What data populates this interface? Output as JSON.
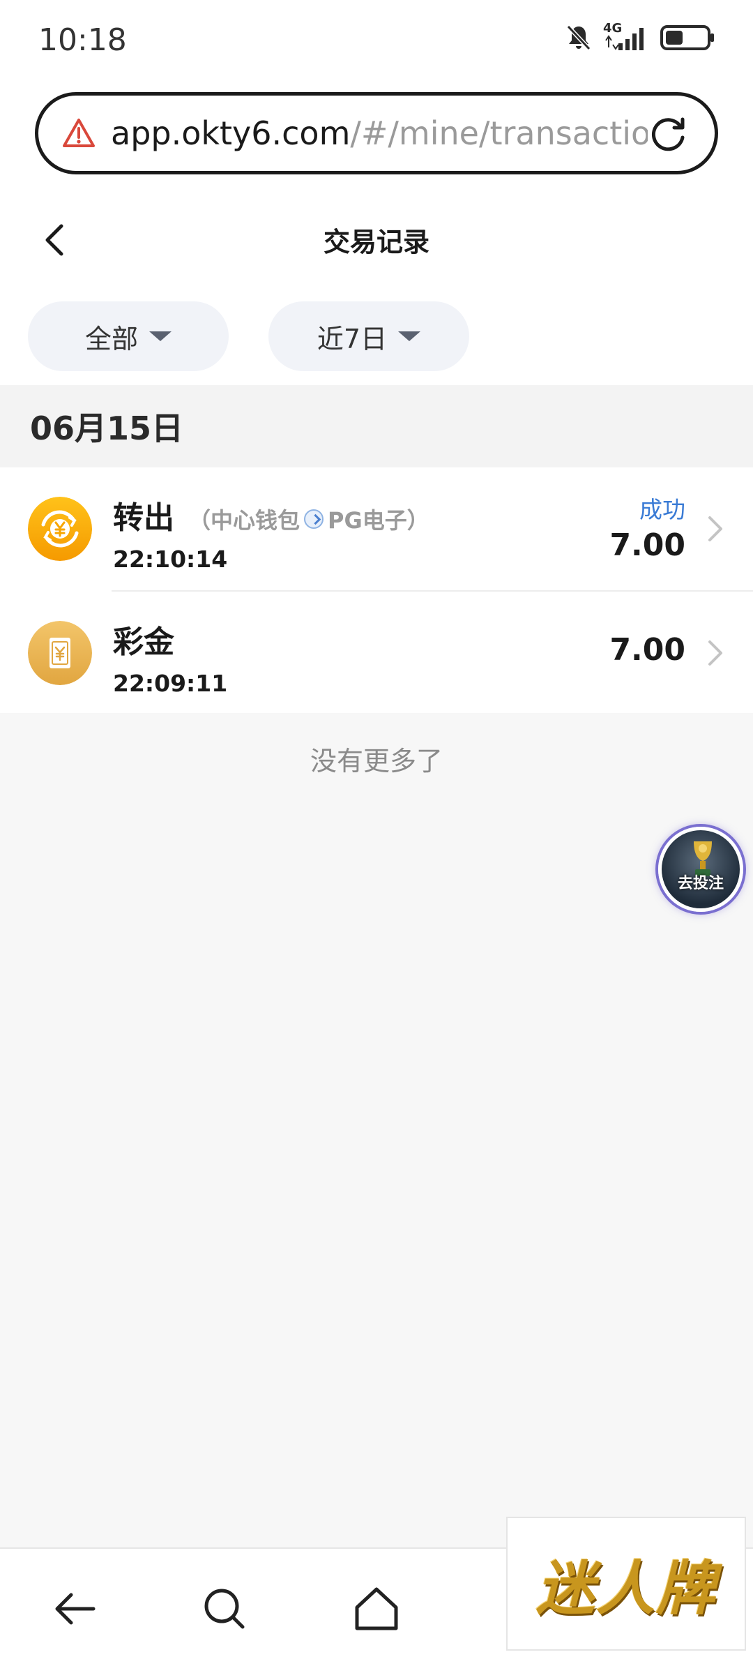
{
  "status_bar": {
    "time": "10:18",
    "network": "4G",
    "icons": [
      "bell-muted-icon",
      "signal-icon",
      "battery-icon"
    ]
  },
  "browser": {
    "url_host": "app.okty6.com",
    "url_path": "/#/mine/transactio",
    "icons": [
      "warning-icon",
      "reload-icon"
    ]
  },
  "header": {
    "title": "交易记录"
  },
  "filters": {
    "type_label": "全部",
    "range_label": "近7日"
  },
  "date_group": {
    "label": "06月15日"
  },
  "transactions": [
    {
      "title": "转出",
      "detail_open": "（中心钱包",
      "detail_close": "PG电子）",
      "time": "22:10:14",
      "status": "成功",
      "amount": "7.00",
      "icon": "transfer-yen-icon"
    },
    {
      "title": "彩金",
      "time": "22:09:11",
      "amount": "7.00",
      "icon": "bonus-voucher-icon"
    }
  ],
  "no_more": "没有更多了",
  "fab": {
    "label": "去投注"
  },
  "bottom_nav": {
    "icons": [
      "back-arrow-icon",
      "search-icon",
      "home-icon"
    ]
  },
  "brand": {
    "text": "迷人牌"
  },
  "colors": {
    "status_success": "#3a7bd5",
    "coin_orange": "#f7a600",
    "voucher_gold": "#e9b24a"
  }
}
